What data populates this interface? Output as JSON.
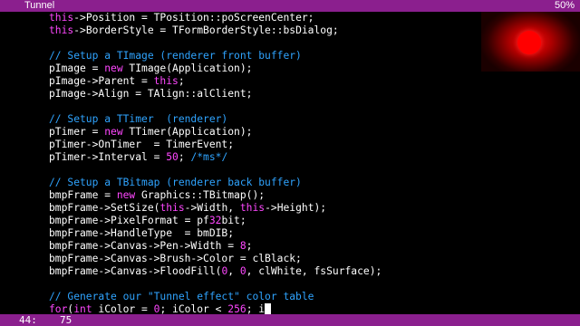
{
  "window": {
    "title": "Tunnel",
    "scroll_percent": "50%"
  },
  "status": {
    "line": "44:",
    "column": "75"
  },
  "code_lines": [
    [
      [
        "t",
        "this"
      ],
      [
        "o",
        "->Position = TPosition::poScreenCenter;"
      ]
    ],
    [
      [
        "t",
        "this"
      ],
      [
        "o",
        "->BorderStyle = TFormBorderStyle::bsDialog;"
      ]
    ],
    [],
    [
      [
        "c",
        "// Setup a TImage (renderer front buffer)"
      ]
    ],
    [
      [
        "o",
        "pImage = "
      ],
      [
        "k",
        "new"
      ],
      [
        "o",
        " TImage(Application);"
      ]
    ],
    [
      [
        "o",
        "pImage->Parent = "
      ],
      [
        "k",
        "this"
      ],
      [
        "o",
        ";"
      ]
    ],
    [
      [
        "o",
        "pImage->Align = TAlign::alClient;"
      ]
    ],
    [],
    [
      [
        "c",
        "// Setup a TTimer  (renderer)"
      ]
    ],
    [
      [
        "o",
        "pTimer = "
      ],
      [
        "k",
        "new"
      ],
      [
        "o",
        " TTimer(Application);"
      ]
    ],
    [
      [
        "o",
        "pTimer->OnTimer  = TimerEvent;"
      ]
    ],
    [
      [
        "o",
        "pTimer->Interval = "
      ],
      [
        "n",
        "50"
      ],
      [
        "o",
        "; "
      ],
      [
        "c",
        "/*ms*/"
      ]
    ],
    [],
    [
      [
        "c",
        "// Setup a TBitmap (renderer back buffer)"
      ]
    ],
    [
      [
        "o",
        "bmpFrame = "
      ],
      [
        "k",
        "new"
      ],
      [
        "o",
        " Graphics::TBitmap();"
      ]
    ],
    [
      [
        "o",
        "bmpFrame->SetSize("
      ],
      [
        "k",
        "this"
      ],
      [
        "o",
        "->Width, "
      ],
      [
        "k",
        "this"
      ],
      [
        "o",
        "->Height);"
      ]
    ],
    [
      [
        "o",
        "bmpFrame->PixelFormat = pf"
      ],
      [
        "n",
        "32"
      ],
      [
        "o",
        "bit;"
      ]
    ],
    [
      [
        "o",
        "bmpFrame->HandleType  = bmDIB;"
      ]
    ],
    [
      [
        "o",
        "bmpFrame->Canvas->Pen->Width = "
      ],
      [
        "n",
        "8"
      ],
      [
        "o",
        ";"
      ]
    ],
    [
      [
        "o",
        "bmpFrame->Canvas->Brush->Color = clBlack;"
      ]
    ],
    [
      [
        "o",
        "bmpFrame->Canvas->FloodFill("
      ],
      [
        "n",
        "0"
      ],
      [
        "o",
        ", "
      ],
      [
        "n",
        "0"
      ],
      [
        "o",
        ", clWhite, fsSurface);"
      ]
    ],
    [],
    [
      [
        "c",
        "// Generate our \"Tunnel effect\" color table"
      ]
    ],
    [
      [
        "k",
        "for"
      ],
      [
        "o",
        "("
      ],
      [
        "k",
        "int"
      ],
      [
        "o",
        " iColor = "
      ],
      [
        "n",
        "0"
      ],
      [
        "o",
        "; iColor < "
      ],
      [
        "n",
        "256"
      ],
      [
        "o",
        "; i"
      ]
    ]
  ],
  "colors": {
    "bar": "#8b1f8e",
    "keyword": "#ff47ff",
    "comment": "#2fa4ff",
    "text": "#ffffff"
  }
}
